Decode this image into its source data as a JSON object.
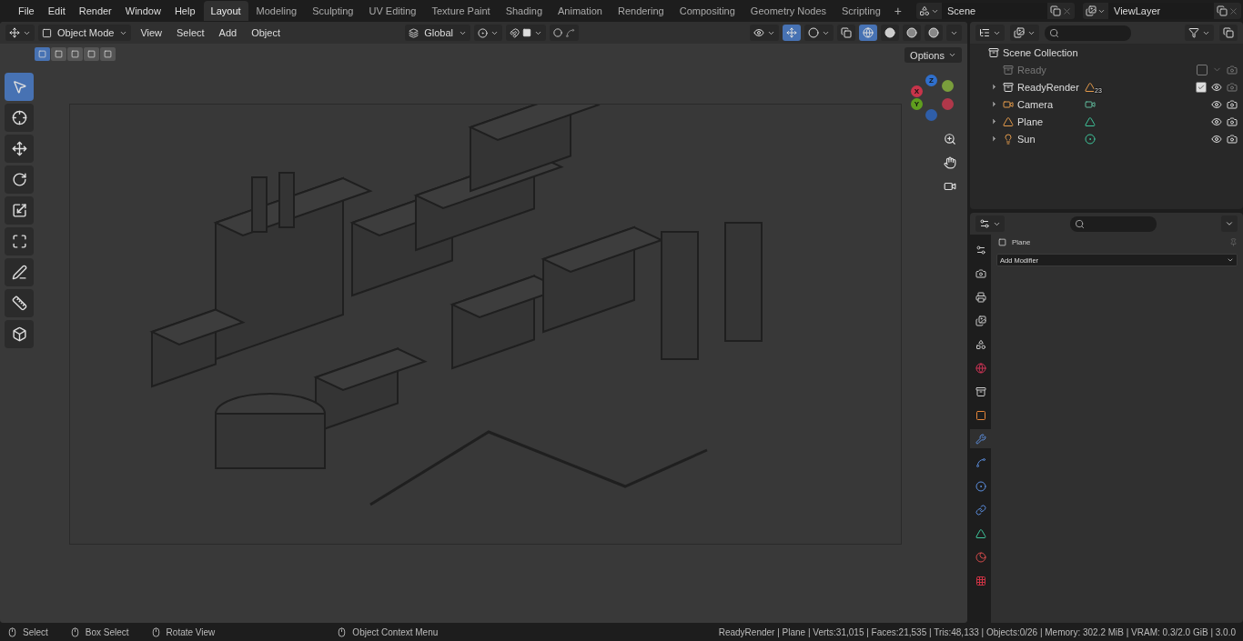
{
  "menu": [
    "File",
    "Edit",
    "Render",
    "Window",
    "Help"
  ],
  "workspaces": [
    {
      "label": "Layout",
      "selected": true
    },
    {
      "label": "Modeling",
      "selected": false
    },
    {
      "label": "Sculpting",
      "selected": false
    },
    {
      "label": "UV Editing",
      "selected": false
    },
    {
      "label": "Texture Paint",
      "selected": false
    },
    {
      "label": "Shading",
      "selected": false
    },
    {
      "label": "Animation",
      "selected": false
    },
    {
      "label": "Rendering",
      "selected": false
    },
    {
      "label": "Compositing",
      "selected": false
    },
    {
      "label": "Geometry Nodes",
      "selected": false
    },
    {
      "label": "Scripting",
      "selected": false
    }
  ],
  "add_workspace": "+",
  "scene": "Scene",
  "view_layer": "ViewLayer",
  "viewport": {
    "mode": "Object Mode",
    "menus": [
      "View",
      "Select",
      "Add",
      "Object"
    ],
    "orientation": "Global",
    "options": "Options",
    "select_modes": [
      {
        "selected": true
      },
      {
        "selected": false
      },
      {
        "selected": false
      },
      {
        "selected": false
      },
      {
        "selected": false
      }
    ],
    "tools": [
      {
        "kind": "select",
        "selected": true
      },
      {
        "kind": "cursor",
        "selected": false
      },
      {
        "kind": "move",
        "selected": false
      },
      {
        "kind": "rotate",
        "selected": false
      },
      {
        "kind": "scale",
        "selected": false
      },
      {
        "kind": "transform",
        "selected": false
      },
      {
        "kind": "annotate",
        "selected": false
      },
      {
        "kind": "measure",
        "selected": false
      },
      {
        "kind": "add",
        "selected": false
      }
    ],
    "gizmos_on": true,
    "shading": [
      {
        "selected": true
      },
      {
        "selected": false
      },
      {
        "selected": false
      },
      {
        "selected": false
      }
    ],
    "axes": [
      {
        "label": "Z",
        "color": "#2f6fcc"
      },
      {
        "label": "X",
        "color": "#c8344a"
      },
      {
        "label": "Y",
        "color": "#5f9e1e"
      }
    ]
  },
  "outliner": {
    "root": {
      "name": "Scene Collection",
      "children": [
        {
          "name": "Ready",
          "kind": "collection",
          "excluded": true,
          "checked": false
        },
        {
          "name": "ReadyRender",
          "kind": "collection",
          "excluded": false,
          "checked": true,
          "badge": "23"
        },
        {
          "name": "Camera",
          "kind": "camera",
          "excluded": false
        },
        {
          "name": "Plane",
          "kind": "mesh",
          "excluded": false
        },
        {
          "name": "Sun",
          "kind": "light",
          "excluded": false
        }
      ]
    }
  },
  "properties": {
    "object": "Plane",
    "add_modifier": "Add Modifier",
    "tabs": [
      {
        "kind": "tool",
        "selected": false
      },
      {
        "kind": "render",
        "selected": false
      },
      {
        "kind": "output",
        "selected": false
      },
      {
        "kind": "view_layer",
        "selected": false
      },
      {
        "kind": "scene",
        "selected": false
      },
      {
        "kind": "world",
        "selected": false
      },
      {
        "kind": "collection",
        "selected": false
      },
      {
        "kind": "object",
        "selected": false
      },
      {
        "kind": "modifiers",
        "selected": true
      },
      {
        "kind": "particles",
        "selected": false
      },
      {
        "kind": "physics",
        "selected": false
      },
      {
        "kind": "constraints",
        "selected": false
      },
      {
        "kind": "data",
        "selected": false
      },
      {
        "kind": "material",
        "selected": false
      },
      {
        "kind": "texture",
        "selected": false
      }
    ]
  },
  "status_bar": {
    "hints": [
      "Select",
      "Box Select",
      "Rotate View",
      "Object Context Menu"
    ],
    "stats": "ReadyRender | Plane | Verts:31,015 | Faces:21,535 | Tris:48,133 | Objects:0/26 | Memory: 302.2 MiB | VRAM: 0.3/2.0 GiB | 3.0.0"
  }
}
